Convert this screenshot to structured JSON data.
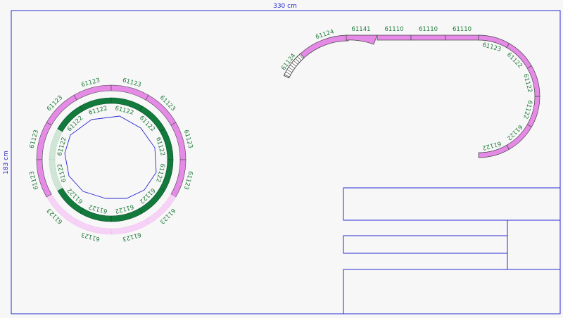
{
  "canvas": {
    "width_label": "330 cm",
    "height_label": "183 cm"
  },
  "colors": {
    "frame": "#2a2ad0",
    "track_pink": "#e58ae6",
    "track_pink_light": "#f6d3f6",
    "track_green": "#127a3c",
    "track_green_light": "#cfe5d6",
    "label": "#1f7a3a",
    "buffer": "#ffffff"
  },
  "circle_track": {
    "outer_ring_labels": [
      "61123",
      "61123",
      "61123",
      "61123",
      "61123",
      "61123",
      "61123",
      "61123",
      "61123",
      "61123",
      "61123",
      "61123"
    ],
    "inner_ring_labels": [
      "61122",
      "61122",
      "61122",
      "61122",
      "61122",
      "61122",
      "61122",
      "61122",
      "61122",
      "61122",
      "61122",
      "61122"
    ]
  },
  "upper_track": {
    "segments": [
      "61124",
      "61124",
      "61141",
      "61110",
      "61110",
      "61110",
      "61123",
      "61122",
      "61122",
      "61122",
      "61122",
      "61122"
    ]
  }
}
